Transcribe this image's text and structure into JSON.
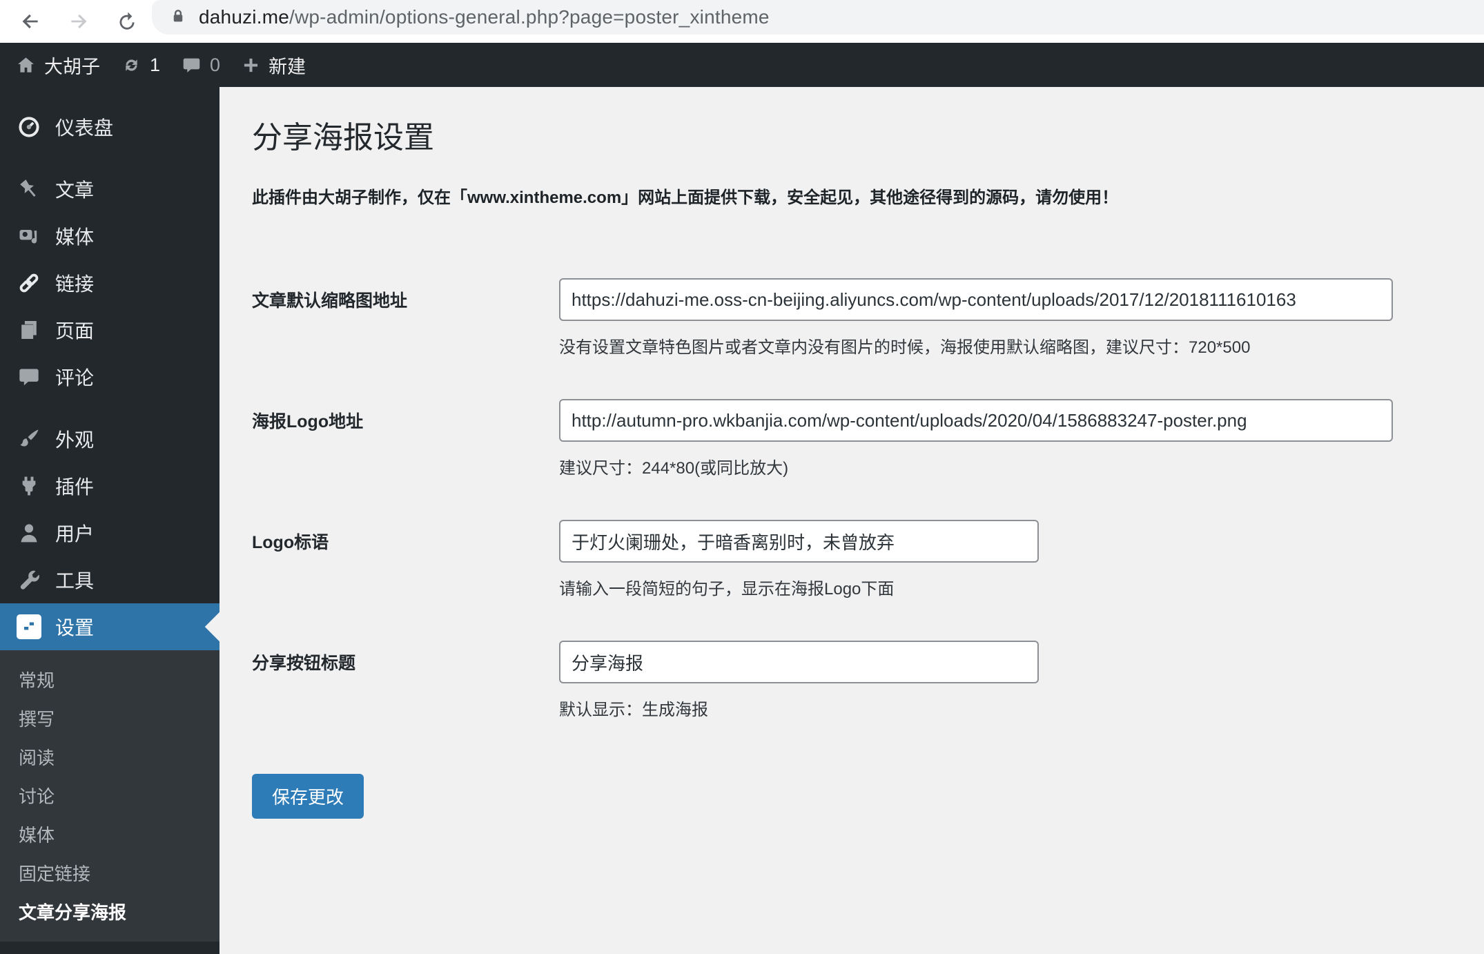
{
  "browser": {
    "url_domain": "dahuzi.me",
    "url_path": "/wp-admin/options-general.php?page=poster_xintheme"
  },
  "admin_bar": {
    "site_name": "大胡子",
    "update_count": "1",
    "comment_count": "0",
    "new_label": "新建"
  },
  "sidebar": {
    "menu": [
      {
        "key": "dashboard",
        "label": "仪表盘",
        "icon": "dashboard-icon",
        "group_start": false,
        "active": false
      },
      {
        "key": "posts",
        "label": "文章",
        "icon": "pushpin-icon",
        "group_start": true,
        "active": false
      },
      {
        "key": "media",
        "label": "媒体",
        "icon": "media-icon",
        "group_start": false,
        "active": false
      },
      {
        "key": "links",
        "label": "链接",
        "icon": "link-icon",
        "group_start": false,
        "active": false
      },
      {
        "key": "pages",
        "label": "页面",
        "icon": "pages-icon",
        "group_start": false,
        "active": false
      },
      {
        "key": "comments",
        "label": "评论",
        "icon": "comment-icon",
        "group_start": false,
        "active": false
      },
      {
        "key": "appearance",
        "label": "外观",
        "icon": "brush-icon",
        "group_start": true,
        "active": false
      },
      {
        "key": "plugins",
        "label": "插件",
        "icon": "plug-icon",
        "group_start": false,
        "active": false
      },
      {
        "key": "users",
        "label": "用户",
        "icon": "user-icon",
        "group_start": false,
        "active": false
      },
      {
        "key": "tools",
        "label": "工具",
        "icon": "wrench-icon",
        "group_start": false,
        "active": false
      },
      {
        "key": "settings",
        "label": "设置",
        "icon": "sliders-icon",
        "group_start": false,
        "active": true
      }
    ],
    "submenu": [
      {
        "key": "general",
        "label": "常规",
        "current": false
      },
      {
        "key": "writing",
        "label": "撰写",
        "current": false
      },
      {
        "key": "reading",
        "label": "阅读",
        "current": false
      },
      {
        "key": "discussion",
        "label": "讨论",
        "current": false
      },
      {
        "key": "media",
        "label": "媒体",
        "current": false
      },
      {
        "key": "permalinks",
        "label": "固定链接",
        "current": false
      },
      {
        "key": "poster",
        "label": "文章分享海报",
        "current": true
      }
    ]
  },
  "main": {
    "title": "分享海报设置",
    "notice": "此插件由大胡子制作，仅在「www.xintheme.com」网站上面提供下载，安全起见，其他途径得到的源码，请勿使用！",
    "fields": [
      {
        "key": "thumbnail-url",
        "label": "文章默认缩略图地址",
        "value": "https://dahuzi-me.oss-cn-beijing.aliyuncs.com/wp-content/uploads/2017/12/2018111610163",
        "help": "没有设置文章特色图片或者文章内没有图片的时候，海报使用默认缩略图，建议尺寸：720*500",
        "wide": true
      },
      {
        "key": "logo-url",
        "label": "海报Logo地址",
        "value": "http://autumn-pro.wkbanjia.com/wp-content/uploads/2020/04/1586883247-poster.png",
        "help": "建议尺寸：244*80(或同比放大)",
        "wide": true
      },
      {
        "key": "logo-slogan",
        "label": "Logo标语",
        "value": "于灯火阑珊处，于暗香离别时，未曾放弃",
        "help": "请输入一段简短的句子，显示在海报Logo下面",
        "wide": false
      },
      {
        "key": "share-button-title",
        "label": "分享按钮标题",
        "value": "分享海报",
        "help": "默认显示：生成海报",
        "wide": false
      }
    ],
    "save_button": "保存更改"
  },
  "colors": {
    "admin_dark": "#23282d",
    "submenu_dark": "#32373c",
    "menu_highlight": "#2e74a8",
    "button_blue": "#2e7cb7",
    "content_bg": "#f1f1f2",
    "url_pill": "#f1f3f4"
  }
}
